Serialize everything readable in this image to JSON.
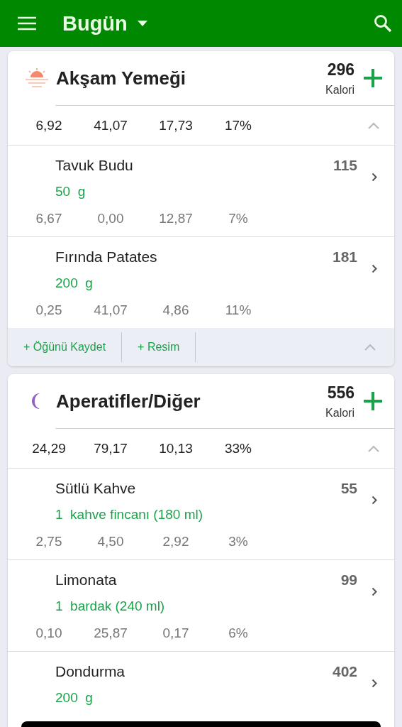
{
  "app_bar": {
    "title": "Bugün"
  },
  "meals": [
    {
      "kind": "sunset",
      "title": "Akşam Yemeği",
      "calories": "296",
      "calories_label": "Kalori",
      "totals": [
        "6,92",
        "41,07",
        "17,73",
        "17%"
      ],
      "expanded": true,
      "foods": [
        {
          "name": "Tavuk Budu",
          "calories": "115",
          "amount": "50  g",
          "nutrients": [
            "6,67",
            "0,00",
            "12,87",
            "7%"
          ]
        },
        {
          "name": "Fırında Patates",
          "calories": "181",
          "amount": "200  g",
          "nutrients": [
            "0,25",
            "41,07",
            "4,86",
            "11%"
          ]
        }
      ],
      "actions": [
        "+ Öğünü Kaydet",
        "+ Resim"
      ]
    },
    {
      "kind": "moon",
      "title": "Aperatifler/Diğer",
      "calories": "556",
      "calories_label": "Kalori",
      "totals": [
        "24,29",
        "79,17",
        "10,13",
        "33%"
      ],
      "expanded": true,
      "foods": [
        {
          "name": "Sütlü Kahve",
          "calories": "55",
          "amount": "1  kahve fincanı (180 ml)",
          "nutrients": [
            "2,75",
            "4,50",
            "2,92",
            "3%"
          ]
        },
        {
          "name": "Limonata",
          "calories": "99",
          "amount": "1  bardak (240 ml)",
          "nutrients": [
            "0,10",
            "25,87",
            "0,17",
            "6%"
          ]
        },
        {
          "name": "Dondurma",
          "calories": "402",
          "amount": "200  g"
        }
      ]
    }
  ]
}
